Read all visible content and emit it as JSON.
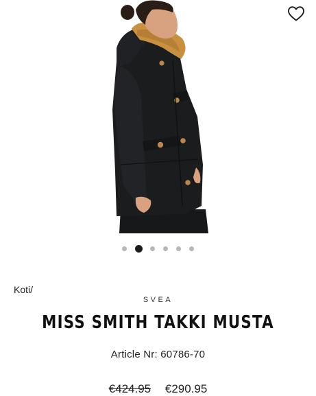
{
  "carousel": {
    "total": 6,
    "active_index": 1
  },
  "breadcrumb": {
    "home_label": "Koti/"
  },
  "product": {
    "brand": "SVEA",
    "title": "MISS SMITH TAKKI MUSTA",
    "article": "Article Nr: 60786-70",
    "old_price": "€424.95",
    "price": "€290.95"
  },
  "icons": {
    "wishlist": "heart-outline-icon"
  },
  "colors": {
    "coat": "#1b1c1e",
    "fur": "#c9913f",
    "button": "#b9874a",
    "active_dot": "#1c1c1c",
    "inactive_dot": "#b7b7b7"
  }
}
